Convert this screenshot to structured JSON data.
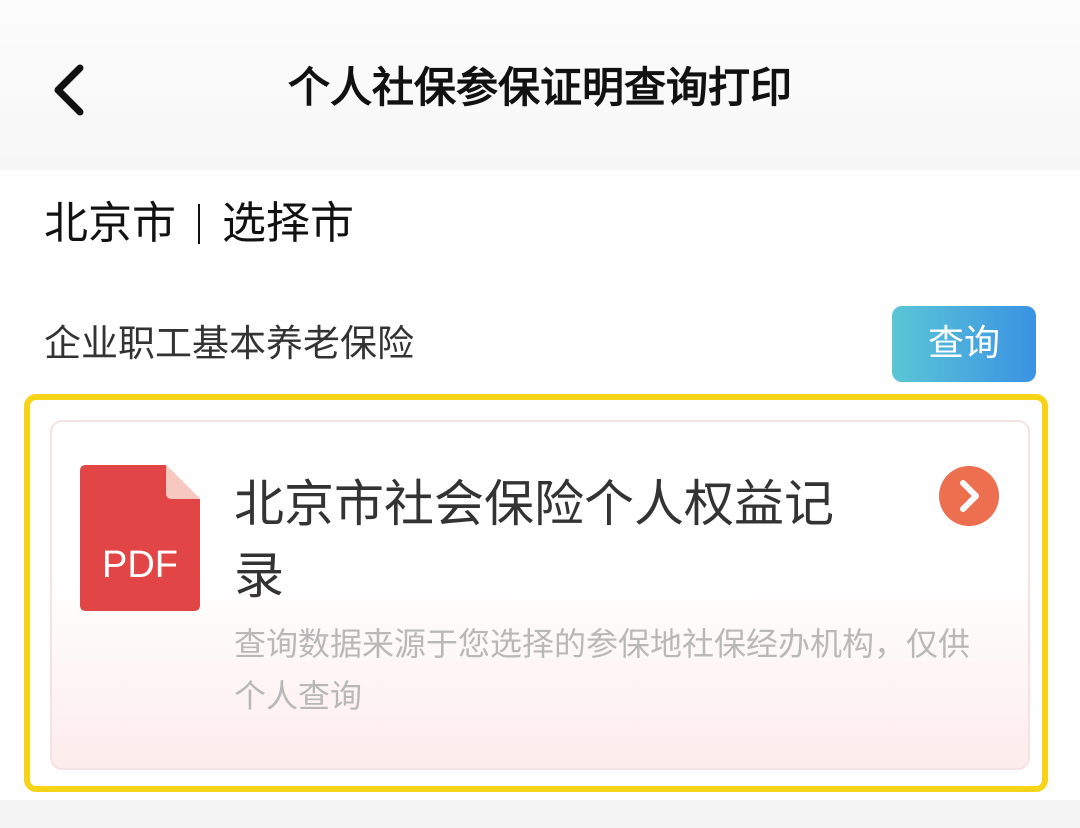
{
  "header": {
    "title": "个人社保参保证明查询打印",
    "back_icon": "chevron-left-icon"
  },
  "location": {
    "city": "北京市",
    "select_label": "选择市"
  },
  "insurance": {
    "type_label": "企业职工基本养老保险",
    "query_label": "查询"
  },
  "document": {
    "icon_text": "PDF",
    "title": "北京市社会保险个人权益记录",
    "description": "查询数据来源于您选择的参保地社保经办机构，仅供个人查询",
    "arrow_icon": "chevron-right-circle-icon"
  },
  "colors": {
    "accent_gradient_start": "#5bc6d6",
    "accent_gradient_end": "#3a92e3",
    "pdf_red": "#e24545",
    "arrow_orange": "#ee6f4f",
    "highlight_yellow": "#f8d419"
  }
}
